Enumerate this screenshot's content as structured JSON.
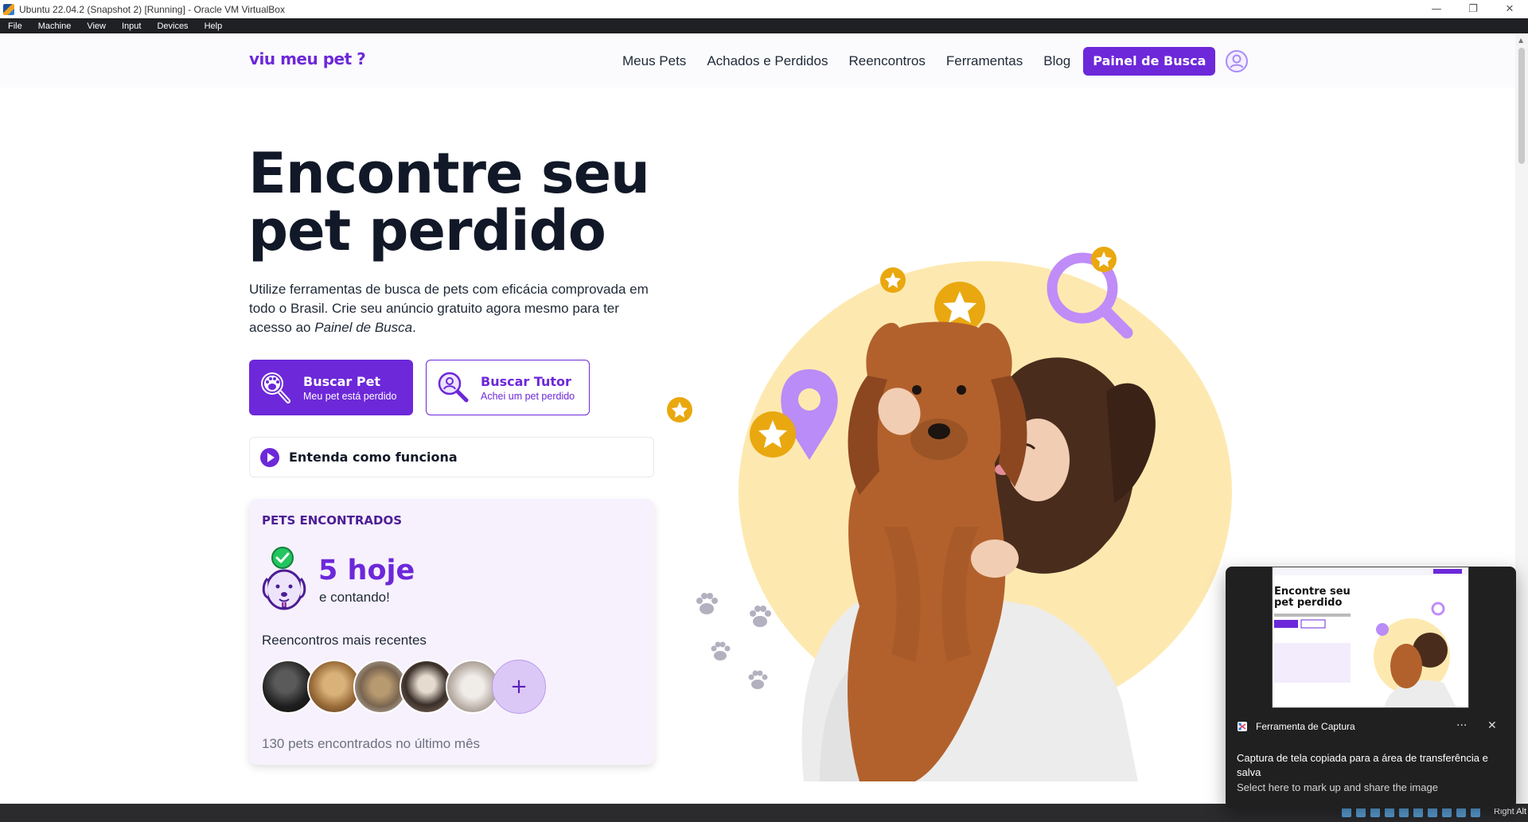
{
  "window": {
    "title": "Ubuntu 22.04.2 (Snapshot 2) [Running] - Oracle VM VirtualBox",
    "menu": [
      "File",
      "Machine",
      "View",
      "Input",
      "Devices",
      "Help"
    ],
    "controls": [
      "minimize-icon",
      "restore-icon",
      "close-icon"
    ]
  },
  "site": {
    "logo": "viu meu pet ?",
    "nav": [
      "Meus Pets",
      "Achados e Perdidos",
      "Reencontros",
      "Ferramentas",
      "Blog"
    ],
    "cta": "Painel de Busca",
    "user_icon": "user-circle-icon"
  },
  "hero": {
    "title_line1": "Encontre seu",
    "title_line2": "pet perdido",
    "desc_main": "Utilize ferramentas de busca de pets com eficácia comprovada em todo o Brasil. Crie seu anúncio gratuito agora mesmo para ter acesso ao ",
    "desc_em": "Painel de Busca",
    "desc_end": "."
  },
  "actions": {
    "buscar_pet": {
      "title": "Buscar Pet",
      "subtitle": "Meu pet está perdido",
      "icon": "paw-search-icon"
    },
    "buscar_tutor": {
      "title": "Buscar Tutor",
      "subtitle": "Achei um pet perdido",
      "icon": "person-search-icon"
    }
  },
  "how_it_works": {
    "label": "Entenda como funciona",
    "icon": "play-icon"
  },
  "stats": {
    "heading": "PETS ENCONTRADOS",
    "today": "5 hoje",
    "counting": "e contando!",
    "recent_label": "Reencontros mais recentes",
    "avatar_count": 5,
    "more_symbol": "+",
    "month_count": "130 pets encontrados no último mês"
  },
  "colors": {
    "brand": "#6d28d9",
    "brand_dark": "#4c1d95",
    "star": "#e9a80f",
    "blob": "#fde9b0",
    "card_bg": "#f7f1fe"
  },
  "taskbar": {
    "right_label": "Right Alt"
  },
  "toast": {
    "thumb_title_1": "Encontre seu",
    "thumb_title_2": "pet perdido",
    "app_name": "Ferramenta de Captura",
    "more": "···",
    "close": "✕",
    "message": "Captura de tela copiada para a área de transferência e salva",
    "hint": "Select here to mark up and share the image"
  }
}
